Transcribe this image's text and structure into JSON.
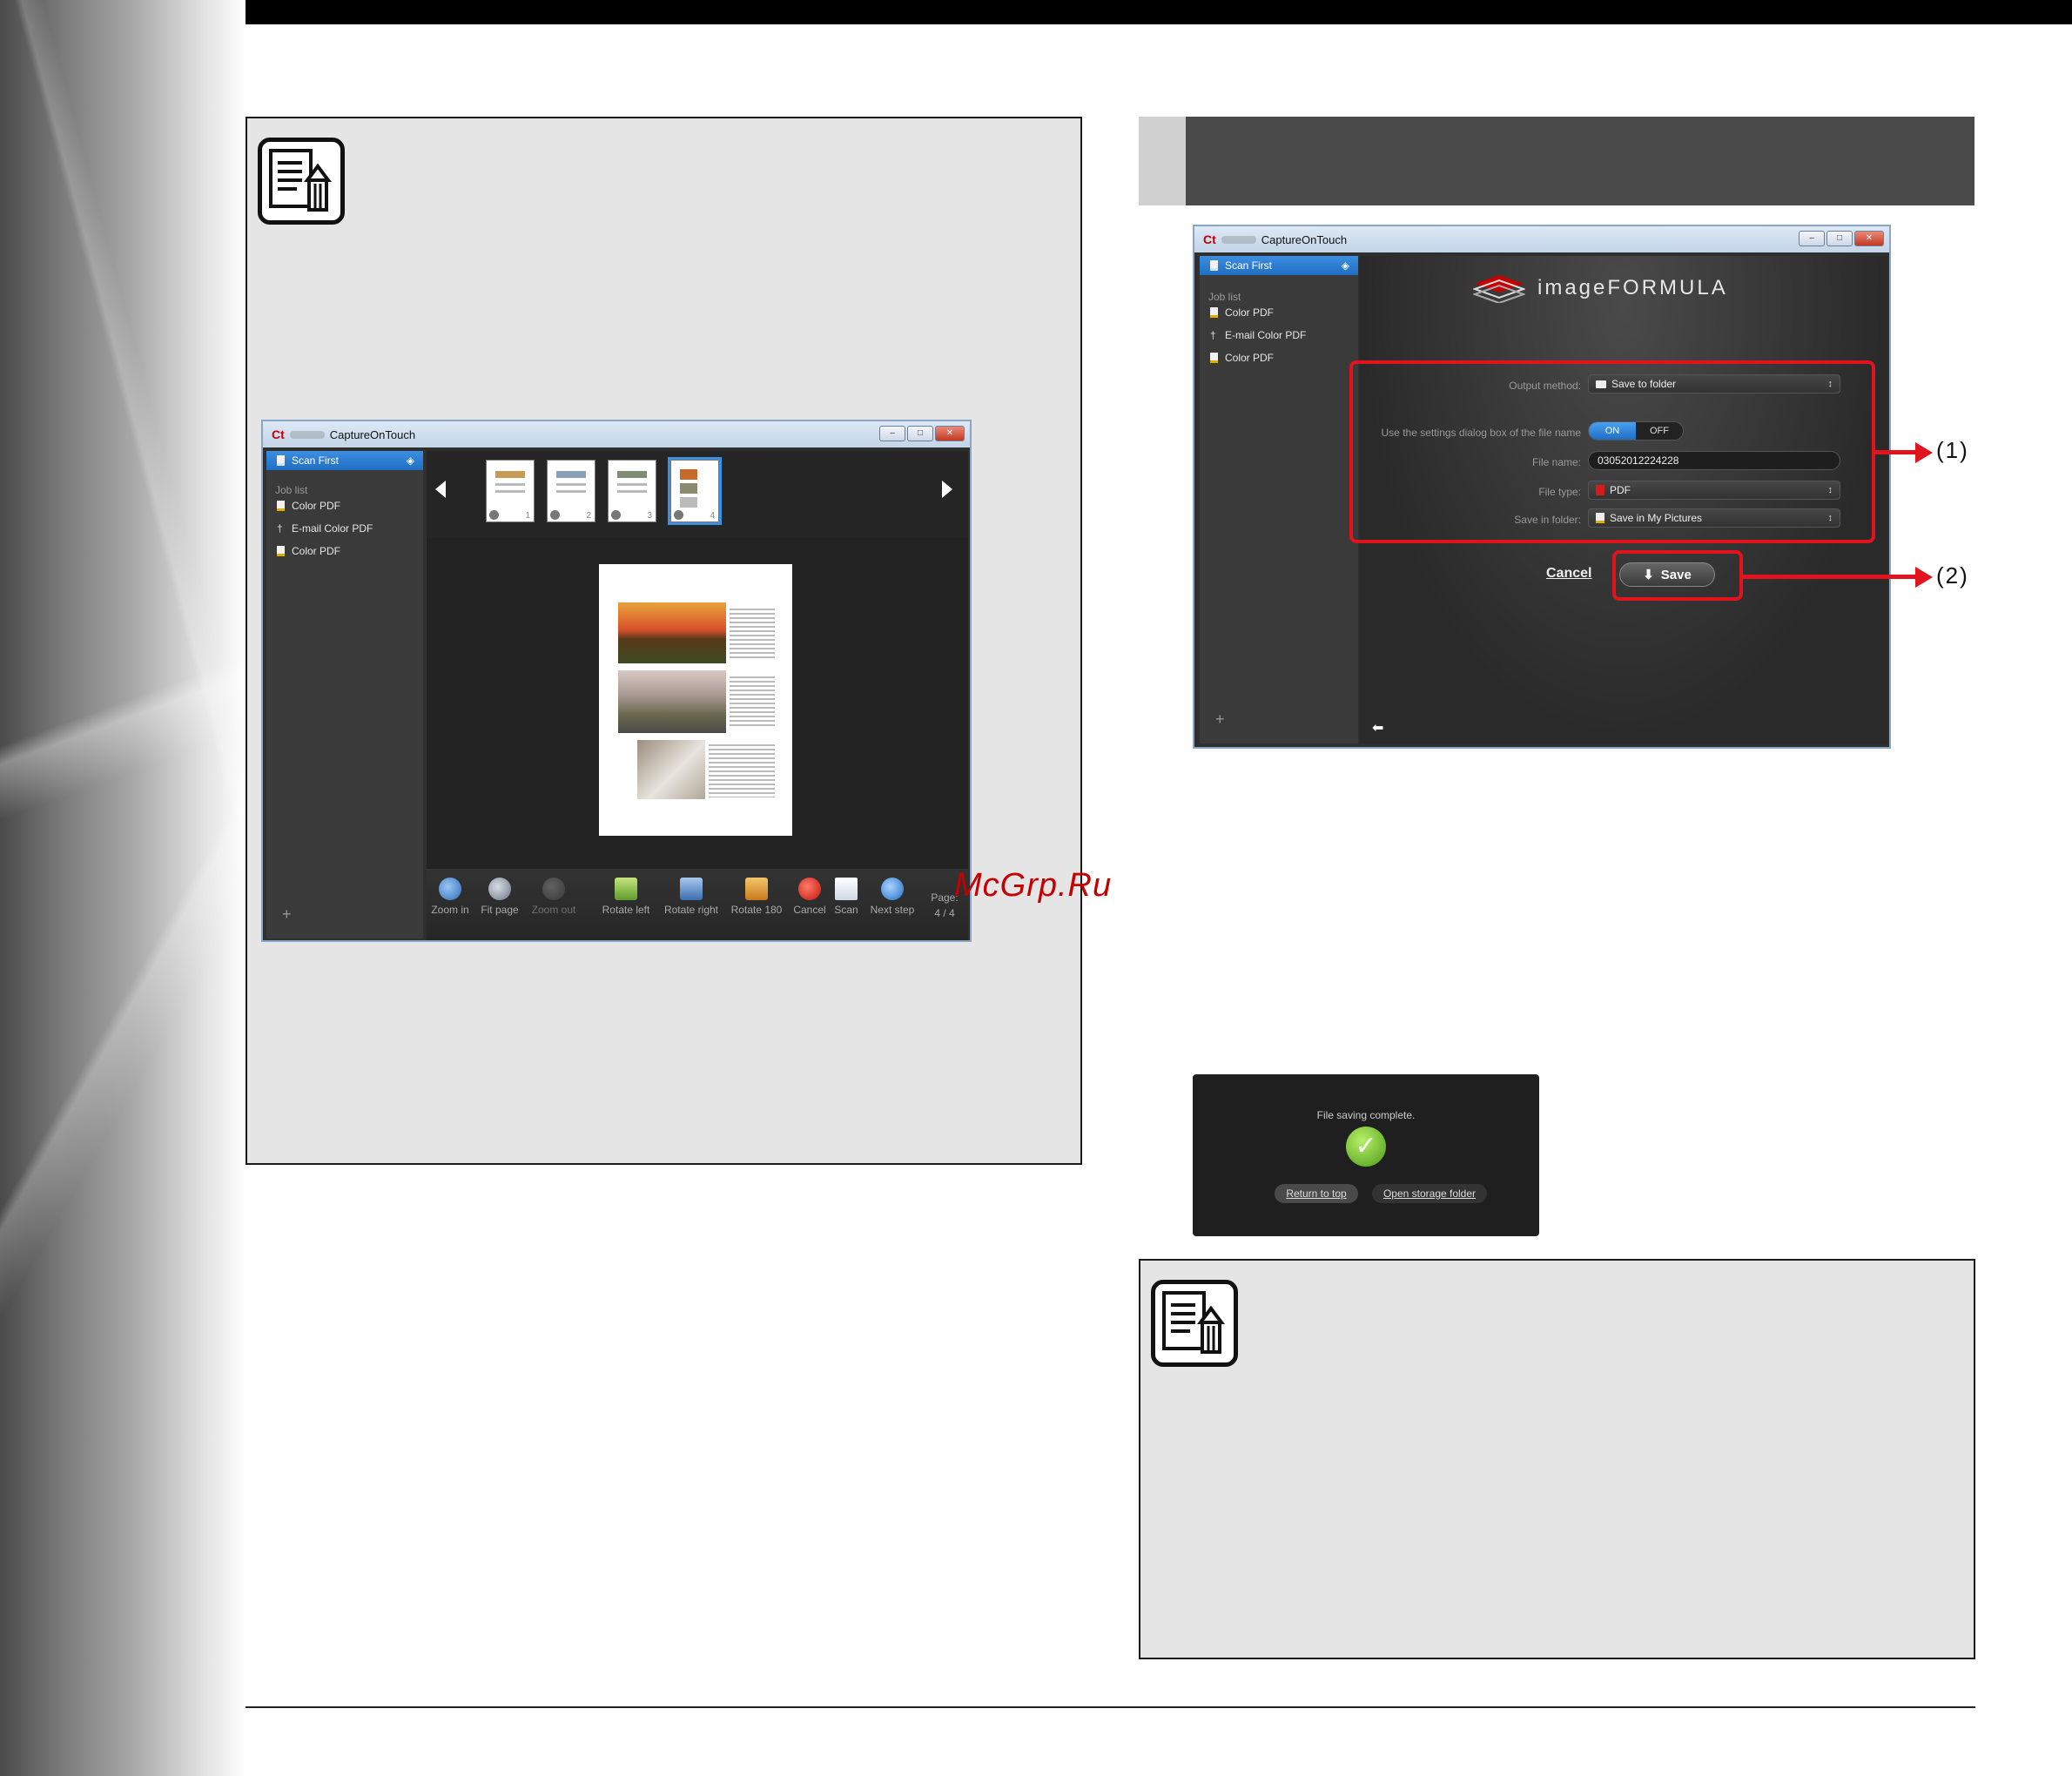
{
  "watermark": "McGrp.Ru",
  "window_a": {
    "title": "CaptureOnTouch",
    "sidebar": {
      "active": "Scan First",
      "job_list_label": "Job list",
      "jobs": [
        "Color PDF",
        "E-mail Color PDF",
        "Color PDF"
      ],
      "add": "+"
    },
    "thumbs": [
      "1",
      "2",
      "3",
      "4"
    ],
    "toolbar": [
      "Zoom in",
      "Fit page",
      "Zoom out",
      "Rotate left",
      "Rotate right",
      "Rotate 180",
      "Cancel",
      "Scan",
      "Next step"
    ],
    "page_label": "Page:",
    "page_value": "4 / 4"
  },
  "window_b": {
    "title": "CaptureOnTouch",
    "sidebar": {
      "active": "Scan First",
      "job_list_label": "Job list",
      "jobs": [
        "Color PDF",
        "E-mail Color PDF",
        "Color PDF"
      ],
      "add": "+"
    },
    "brand": "imageFORMULA",
    "form": {
      "output_method_label": "Output method:",
      "output_method_value": "Save to folder",
      "use_settings_label": "Use the settings dialog box of the file name",
      "toggle_on": "ON",
      "toggle_off": "OFF",
      "file_name_label": "File name:",
      "file_name_value": "03052012224228",
      "file_type_label": "File type:",
      "file_type_value": "PDF",
      "save_in_label": "Save in folder:",
      "save_in_value": "Save in My Pictures"
    },
    "cancel": "Cancel",
    "save": "Save",
    "callout_1": "(1)",
    "callout_2": "(2)"
  },
  "completion": {
    "message": "File saving complete.",
    "return_btn": "Return to top",
    "open_btn": "Open storage folder"
  }
}
